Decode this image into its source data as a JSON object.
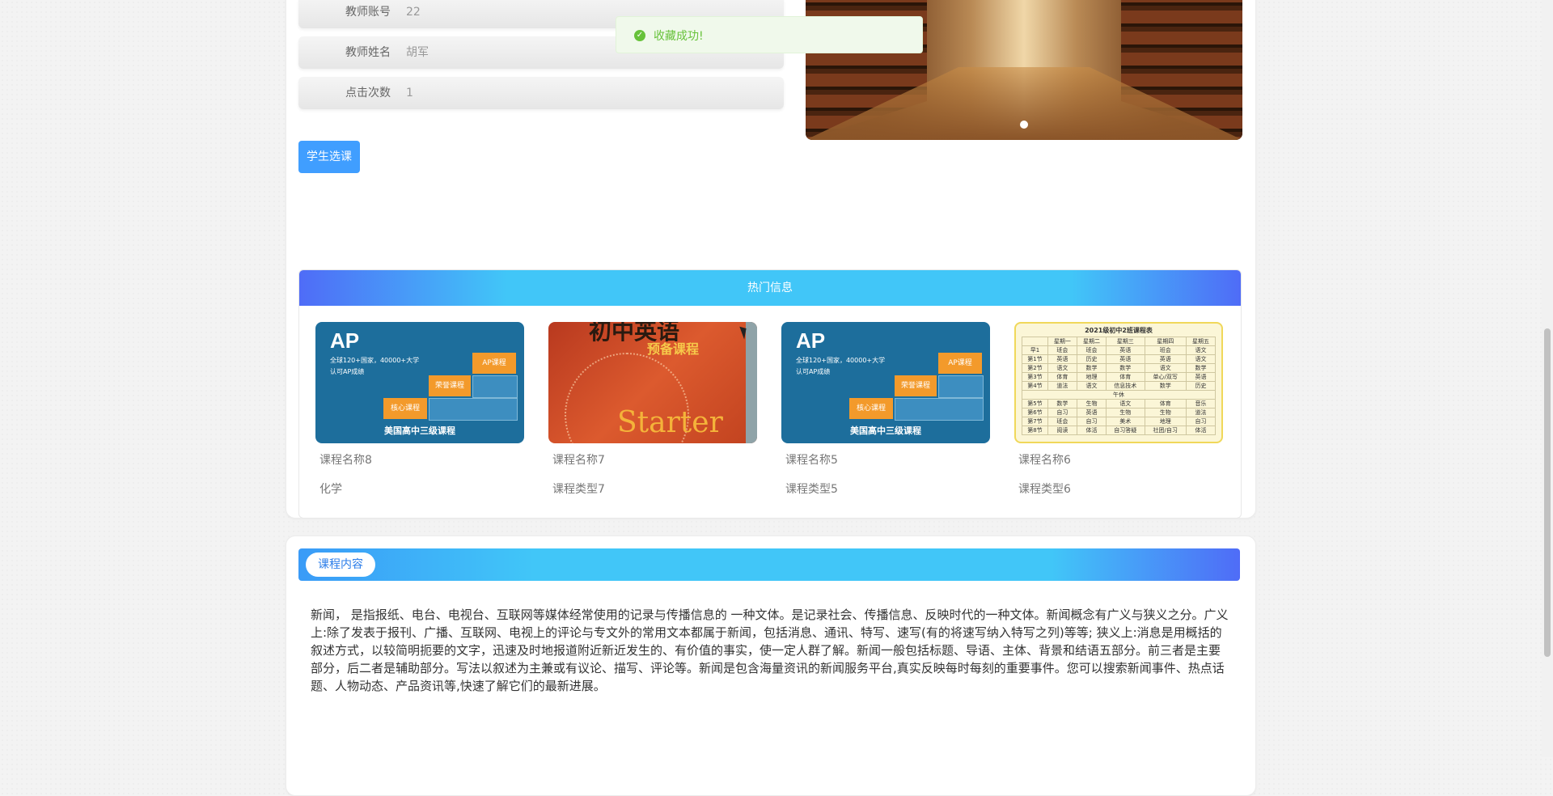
{
  "info_rows": [
    {
      "label": "教师账号",
      "value": "22"
    },
    {
      "label": "教师姓名",
      "value": "胡军"
    },
    {
      "label": "点击次数",
      "value": "1"
    }
  ],
  "actions": {
    "select_course": "学生选课"
  },
  "toast": {
    "message": "收藏成功!",
    "icon": "check-circle-icon",
    "color": "#67c23a"
  },
  "hot": {
    "title": "热门信息",
    "items": [
      {
        "name": "课程名称8",
        "type": "化学"
      },
      {
        "name": "课程名称7",
        "type": "课程类型7"
      },
      {
        "name": "课程名称5",
        "type": "课程类型5"
      },
      {
        "name": "课程名称6",
        "type": "课程类型6"
      }
    ]
  },
  "ap_thumb": {
    "big": "AP",
    "sub1": "全球120+国家，40000+大学",
    "sub2": "认可AP成绩",
    "tag_ap": "AP课程",
    "tag_honor": "荣誉课程",
    "tag_core": "核心课程",
    "footer": "美国高中三级课程"
  },
  "book_thumb": {
    "title": "初中英语",
    "subtitle": "预备课程",
    "word": "Starter"
  },
  "schedule_thumb": {
    "title": "2021级初中2班课程表",
    "rows": [
      [
        "",
        "星期一",
        "星期二",
        "星期三",
        "星期四",
        "星期五"
      ],
      [
        "早1",
        "班会",
        "班会",
        "英语",
        "班会",
        "语文"
      ],
      [
        "第1节",
        "英语",
        "历史",
        "英语",
        "英语",
        "语文"
      ],
      [
        "第2节",
        "语文",
        "数学",
        "数学",
        "语文",
        "数学"
      ],
      [
        "第3节",
        "体育",
        "地理",
        "体育",
        "单心/双写",
        "英语"
      ],
      [
        "第4节",
        "道法",
        "语文",
        "信息技术",
        "数学",
        "历史"
      ],
      [
        "午休",
        "",
        "",
        "",
        "",
        ""
      ],
      [
        "第5节",
        "数学",
        "生物",
        "语文",
        "体育",
        "音乐"
      ],
      [
        "第6节",
        "自习",
        "英语",
        "生物",
        "生物",
        "道法"
      ],
      [
        "第7节",
        "班会",
        "自习",
        "美术",
        "地理",
        "自习"
      ],
      [
        "第8节",
        "阅读",
        "体活",
        "自习答疑",
        "社团/自习",
        "体活"
      ]
    ]
  },
  "content": {
    "pill": "课程内容",
    "text": "新闻， 是指报纸、电台、电视台、互联网等媒体经常使用的记录与传播信息的 一种文体。是记录社会、传播信息、反映时代的一种文体。新闻概念有广义与狭义之分。广义上:除了发表于报刊、广播、互联网、电视上的评论与专文外的常用文本都属于新闻，包括消息、通讯、特写、速写(有的将速写纳入特写之列)等等; 狭义上:消息是用概括的叙述方式，以较简明扼要的文字，迅速及时地报道附近新近发生的、有价值的事实，使一定人群了解。新闻一般包括标题、导语、主体、背景和结语五部分。前三者是主要部分，后二者是辅助部分。写法以叙述为主兼或有议论、描写、评论等。新闻是包含海量资讯的新闻服务平台,真实反映每时每刻的重要事件。您可以搜索新闻事件、热点话题、人物动态、产品资讯等,快速了解它们的最新进展。"
  }
}
